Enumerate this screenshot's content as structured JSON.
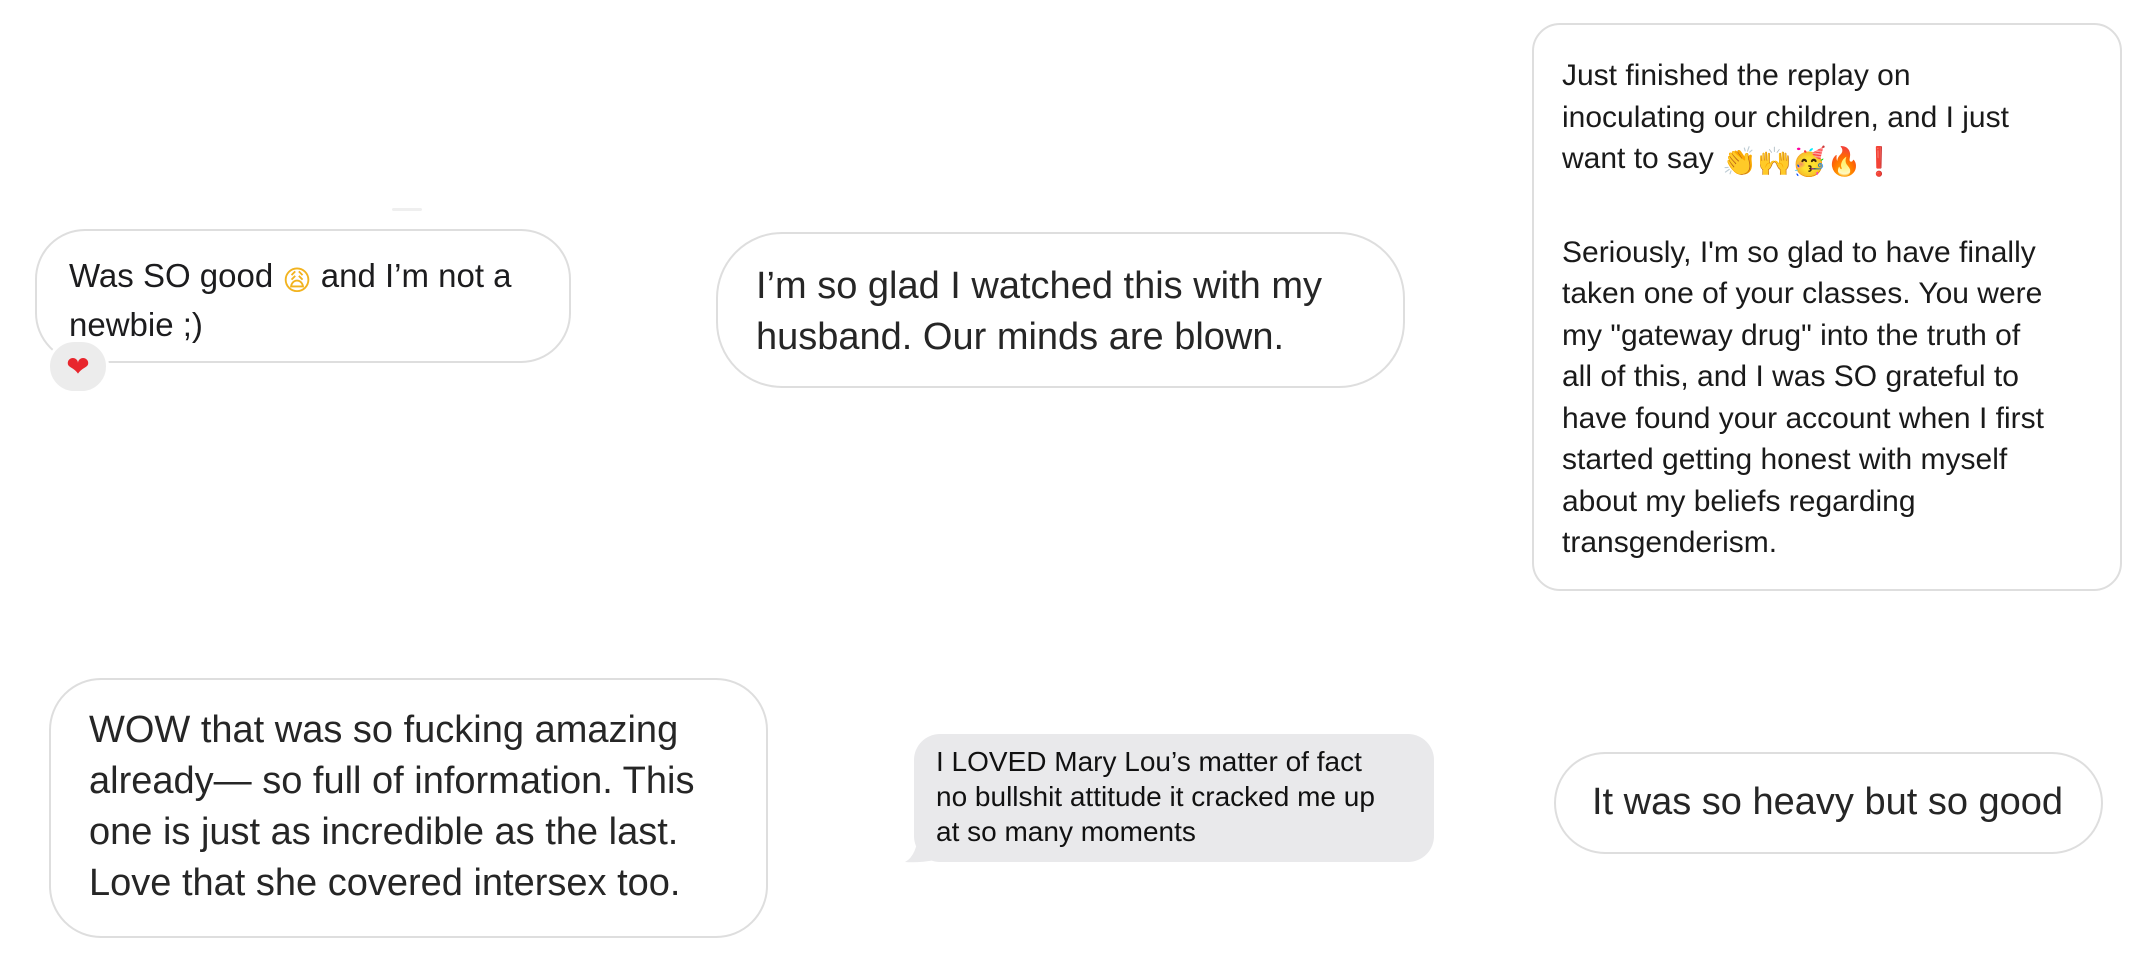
{
  "messages": [
    {
      "text_a": "Was SO good ",
      "emoji": "😩",
      "text_b": " and I’m not a\nnewbie ;)",
      "reaction": "heart",
      "reaction_glyph": "❤"
    },
    {
      "text": "I’m so glad I watched this with my\nhusband. Our minds are blown."
    },
    {
      "para1": "Just finished the replay on\ninoculating our children, and I just\nwant to say ",
      "para1_emojis": [
        "👏",
        "🙌",
        "🥳",
        "🔥",
        "❗"
      ],
      "para2": "Seriously, I'm so glad to have finally\ntaken one of your classes. You were\nmy \"gateway drug\" into the truth of\nall of this, and I was SO grateful to\nhave found your account when I first\nstarted getting honest with myself\nabout my beliefs regarding\ntransgenderism."
    },
    {
      "text": "WOW that was so fucking amazing\nalready— so full of information. This\none is just as incredible as the last.\nLove that she covered intersex too."
    },
    {
      "text": "I LOVED Mary Lou’s matter of fact\nno bullshit attitude it cracked me up\nat so many moments"
    },
    {
      "text": "It was so heavy but so good"
    }
  ],
  "colors": {
    "bubble_border": "#dedede",
    "received_gray": "#e9e9eb",
    "heart_red": "#e8262d"
  }
}
